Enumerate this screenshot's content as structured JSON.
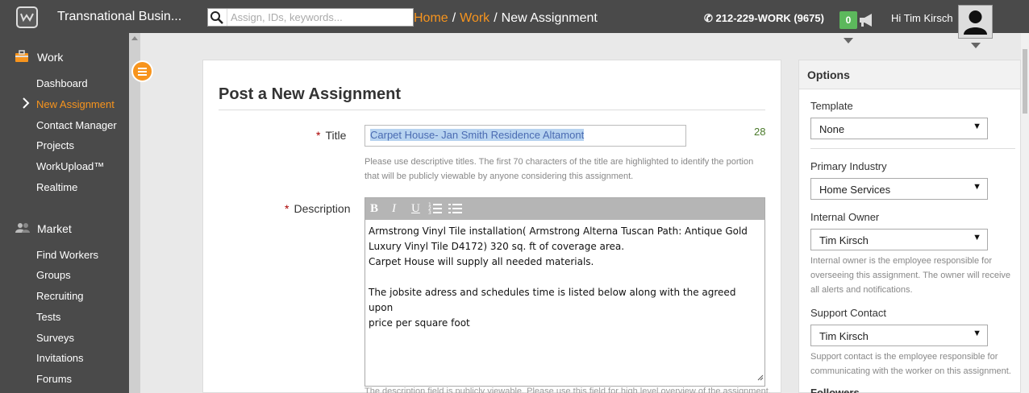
{
  "app": {
    "company": "Transnational Busin...",
    "search_placeholder": "Assign, IDs, keywords...",
    "breadcrumb": [
      "Home",
      "Work",
      "New Assignment"
    ],
    "phone": "212-229-WORK (9675)",
    "notifications_count": "0",
    "greeting": "Hi Tim Kirsch"
  },
  "sidebar": {
    "work_label": "Work",
    "work_items": [
      "Dashboard",
      "New Assignment",
      "Contact Manager",
      "Projects",
      "WorkUpload™",
      "Realtime"
    ],
    "market_label": "Market",
    "market_items": [
      "Find Workers",
      "Groups",
      "Recruiting",
      "Tests",
      "Surveys",
      "Invitations",
      "Forums"
    ]
  },
  "form": {
    "page_title": "Post a New Assignment",
    "title_label": "Title",
    "title_value": "Carpet House- Jan Smith Residence Altamont",
    "title_count": "28",
    "title_help": "Please use descriptive titles. The first 70 characters of the title are highlighted to identify the portion that will be publicly viewable by anyone considering this assignment.",
    "description_label": "Description",
    "description_lines": [
      "Armstrong Vinyl Tile installation( Armstrong Alterna Tuscan Path: Antique Gold",
      "Luxury Vinyl Tile D4172) 320 sq. ft of coverage area.",
      "Carpet House will supply all needed materials.",
      "",
      "The jobsite adress and schedules time is listed below along with the agreed upon",
      "price per square foot"
    ],
    "description_help": "The description field is publicly viewable. Please use this field for high level overview of the assignment."
  },
  "options": {
    "heading": "Options",
    "template_label": "Template",
    "template_value": "None",
    "industry_label": "Primary Industry",
    "industry_value": "Home Services",
    "owner_label": "Internal Owner",
    "owner_value": "Tim Kirsch",
    "owner_help": "Internal owner is the employee responsible for overseeing this assignment. The owner will receive all alerts and notifications.",
    "support_label": "Support Contact",
    "support_value": "Tim Kirsch",
    "support_help": "Support contact is the employee responsible for communicating with the worker on this assignment.",
    "followers_label": "Followers"
  }
}
